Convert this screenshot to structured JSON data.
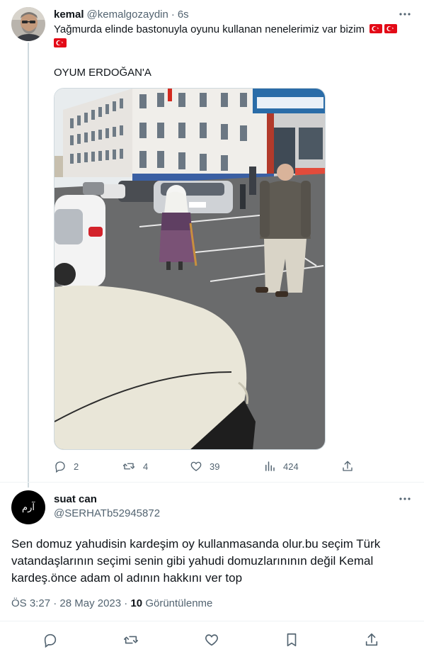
{
  "parent_tweet": {
    "display_name": "kemal",
    "handle": "@kemalgozaydin",
    "separator": "·",
    "time": "6s",
    "text_line1": "Yağmurda elinde bastonuyla oyunu kullanan nenelerimiz var bizim",
    "text_line2": "OYUM ERDOĞAN'A",
    "flag_count": 3,
    "media_description": "elderly woman with cane walking in school parking lot",
    "stats": {
      "replies": "2",
      "retweets": "4",
      "likes": "39",
      "views": "424"
    }
  },
  "reply_tweet": {
    "display_name": "suat can",
    "handle": "@SERHATb52945872",
    "avatar_text": "آرم",
    "text": "Sen domuz yahudisin kardeşim oy kullanmasanda olur.bu seçim Türk vatandaşlarının seçimi senin gibi yahudi domuzlarınının değil Kemal kardeş.önce adam ol adının hakkını ver top",
    "time": "ÖS 3:27",
    "separator1": "·",
    "date": "28 May 2023",
    "separator2": "·",
    "views_count": "10",
    "views_label": "Görüntülenme"
  },
  "colors": {
    "text": "#0f1419",
    "secondary": "#536471",
    "divider": "#eff3f4",
    "thread_line": "#cfd9de",
    "flag_red": "#e30a17"
  },
  "icons": {
    "more": "more-dots-icon",
    "reply": "reply-bubble-icon",
    "retweet": "retweet-icon",
    "like": "heart-icon",
    "views": "bar-chart-icon",
    "share": "share-icon",
    "bookmark": "bookmark-icon"
  }
}
